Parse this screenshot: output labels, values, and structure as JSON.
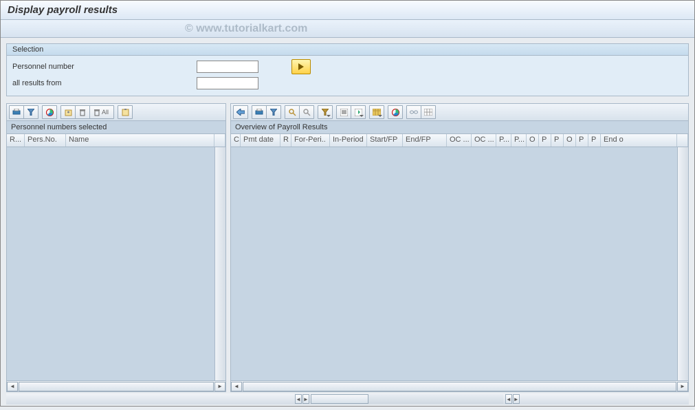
{
  "header": {
    "title": "Display payroll results"
  },
  "watermark": "© www.tutorialkart.com",
  "selection": {
    "group_title": "Selection",
    "personnel_number_label": "Personnel number",
    "personnel_number_value": "",
    "all_results_from_label": "all results from",
    "all_results_from_value": ""
  },
  "left_pane": {
    "title": "Personnel numbers selected",
    "columns": [
      "R...",
      "Pers.No.",
      "Name"
    ]
  },
  "right_pane": {
    "title": "Overview of Payroll Results",
    "columns": [
      "C",
      "Pmt date",
      "R",
      "For-Peri..",
      "In-Period",
      "Start/FP",
      "End/FP",
      "OC ...",
      "OC ...",
      "P...",
      "P...",
      "O",
      "P",
      "P",
      "O",
      "P",
      "P",
      "End o"
    ]
  },
  "toolbar_left": {
    "all_btn_text": "All"
  }
}
